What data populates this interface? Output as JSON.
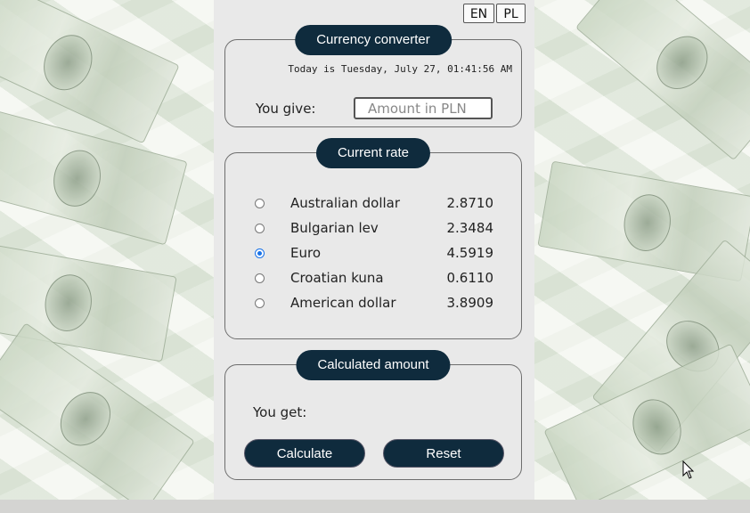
{
  "language_switch": {
    "en": "EN",
    "pl": "PL"
  },
  "converter": {
    "title": "Currency converter",
    "date_text": "Today is Tuesday, July 27, 01:41:56 AM",
    "give_label": "You give:",
    "amount_placeholder": "Amount in PLN",
    "amount_value": ""
  },
  "rates": {
    "title": "Current rate",
    "selected": "Euro",
    "items": [
      {
        "name": "Australian dollar",
        "rate": "2.8710",
        "checked": false
      },
      {
        "name": "Bulgarian lev",
        "rate": "2.3484",
        "checked": false
      },
      {
        "name": "Euro",
        "rate": "4.5919",
        "checked": true
      },
      {
        "name": "Croatian kuna",
        "rate": "0.6110",
        "checked": false
      },
      {
        "name": "American dollar",
        "rate": "3.8909",
        "checked": false
      }
    ]
  },
  "result": {
    "title": "Calculated amount",
    "get_label": "You get:",
    "value": "",
    "calculate_label": "Calculate",
    "reset_label": "Reset"
  },
  "colors": {
    "accent": "#0f2b3d",
    "panel_bg": "#e9e9e9",
    "radio_checked": "#1a73e8"
  },
  "icons": {
    "cursor": "mouse-pointer-icon"
  }
}
